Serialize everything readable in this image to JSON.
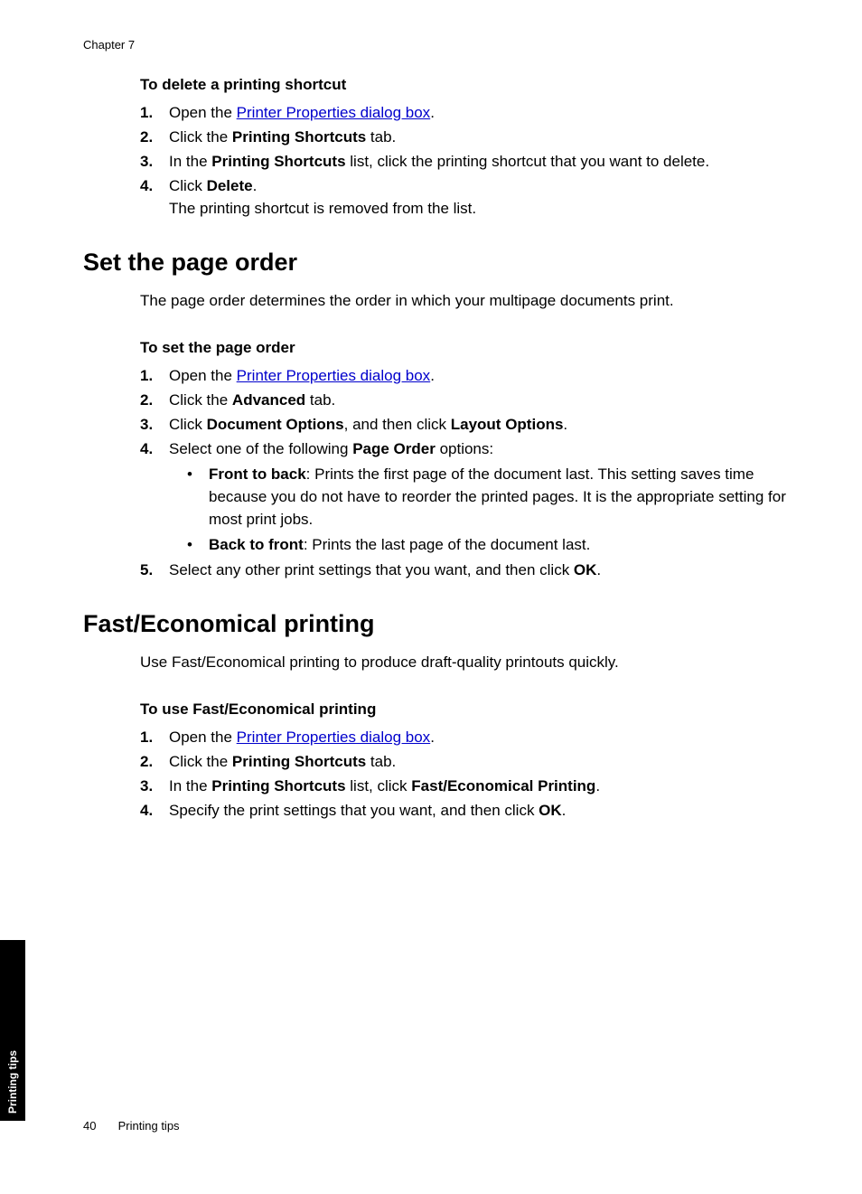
{
  "chapter": "Chapter 7",
  "section1": {
    "heading": "To delete a printing shortcut",
    "step1_prefix": "Open the ",
    "link_text": "Printer Properties dialog box",
    "step1_suffix": ".",
    "step2_a": "Click the ",
    "step2_b": "Printing Shortcuts",
    "step2_c": " tab.",
    "step3_a": "In the ",
    "step3_b": "Printing Shortcuts",
    "step3_c": " list, click the printing shortcut that you want to delete.",
    "step4_a": "Click ",
    "step4_b": "Delete",
    "step4_c": ".",
    "step4_note": "The printing shortcut is removed from the list."
  },
  "section2": {
    "title": "Set the page order",
    "intro": "The page order determines the order in which your multipage documents print.",
    "heading": "To set the page order",
    "step1_prefix": "Open the ",
    "link_text": "Printer Properties dialog box",
    "step1_suffix": ".",
    "step2_a": "Click the ",
    "step2_b": "Advanced",
    "step2_c": " tab.",
    "step3_a": "Click ",
    "step3_b": "Document Options",
    "step3_c": ", and then click ",
    "step3_d": "Layout Options",
    "step3_e": ".",
    "step4_a": "Select one of the following ",
    "step4_b": "Page Order",
    "step4_c": " options:",
    "bullet1_a": "Front to back",
    "bullet1_b": ": Prints the first page of the document last. This setting saves time because you do not have to reorder the printed pages. It is the appropriate setting for most print jobs.",
    "bullet2_a": "Back to front",
    "bullet2_b": ": Prints the last page of the document last.",
    "step5_a": "Select any other print settings that you want, and then click ",
    "step5_b": "OK",
    "step5_c": "."
  },
  "section3": {
    "title": "Fast/Economical printing",
    "intro": "Use Fast/Economical printing to produce draft-quality printouts quickly.",
    "heading": "To use Fast/Economical printing",
    "step1_prefix": "Open the ",
    "link_text": "Printer Properties dialog box",
    "step1_suffix": ".",
    "step2_a": "Click the ",
    "step2_b": "Printing Shortcuts",
    "step2_c": " tab.",
    "step3_a": "In the ",
    "step3_b": "Printing Shortcuts",
    "step3_c": " list, click ",
    "step3_d": "Fast/Economical Printing",
    "step3_e": ".",
    "step4_a": "Specify the print settings that you want, and then click ",
    "step4_b": "OK",
    "step4_c": "."
  },
  "side_tab": "Printing tips",
  "footer": {
    "page_number": "40",
    "title": "Printing tips"
  }
}
